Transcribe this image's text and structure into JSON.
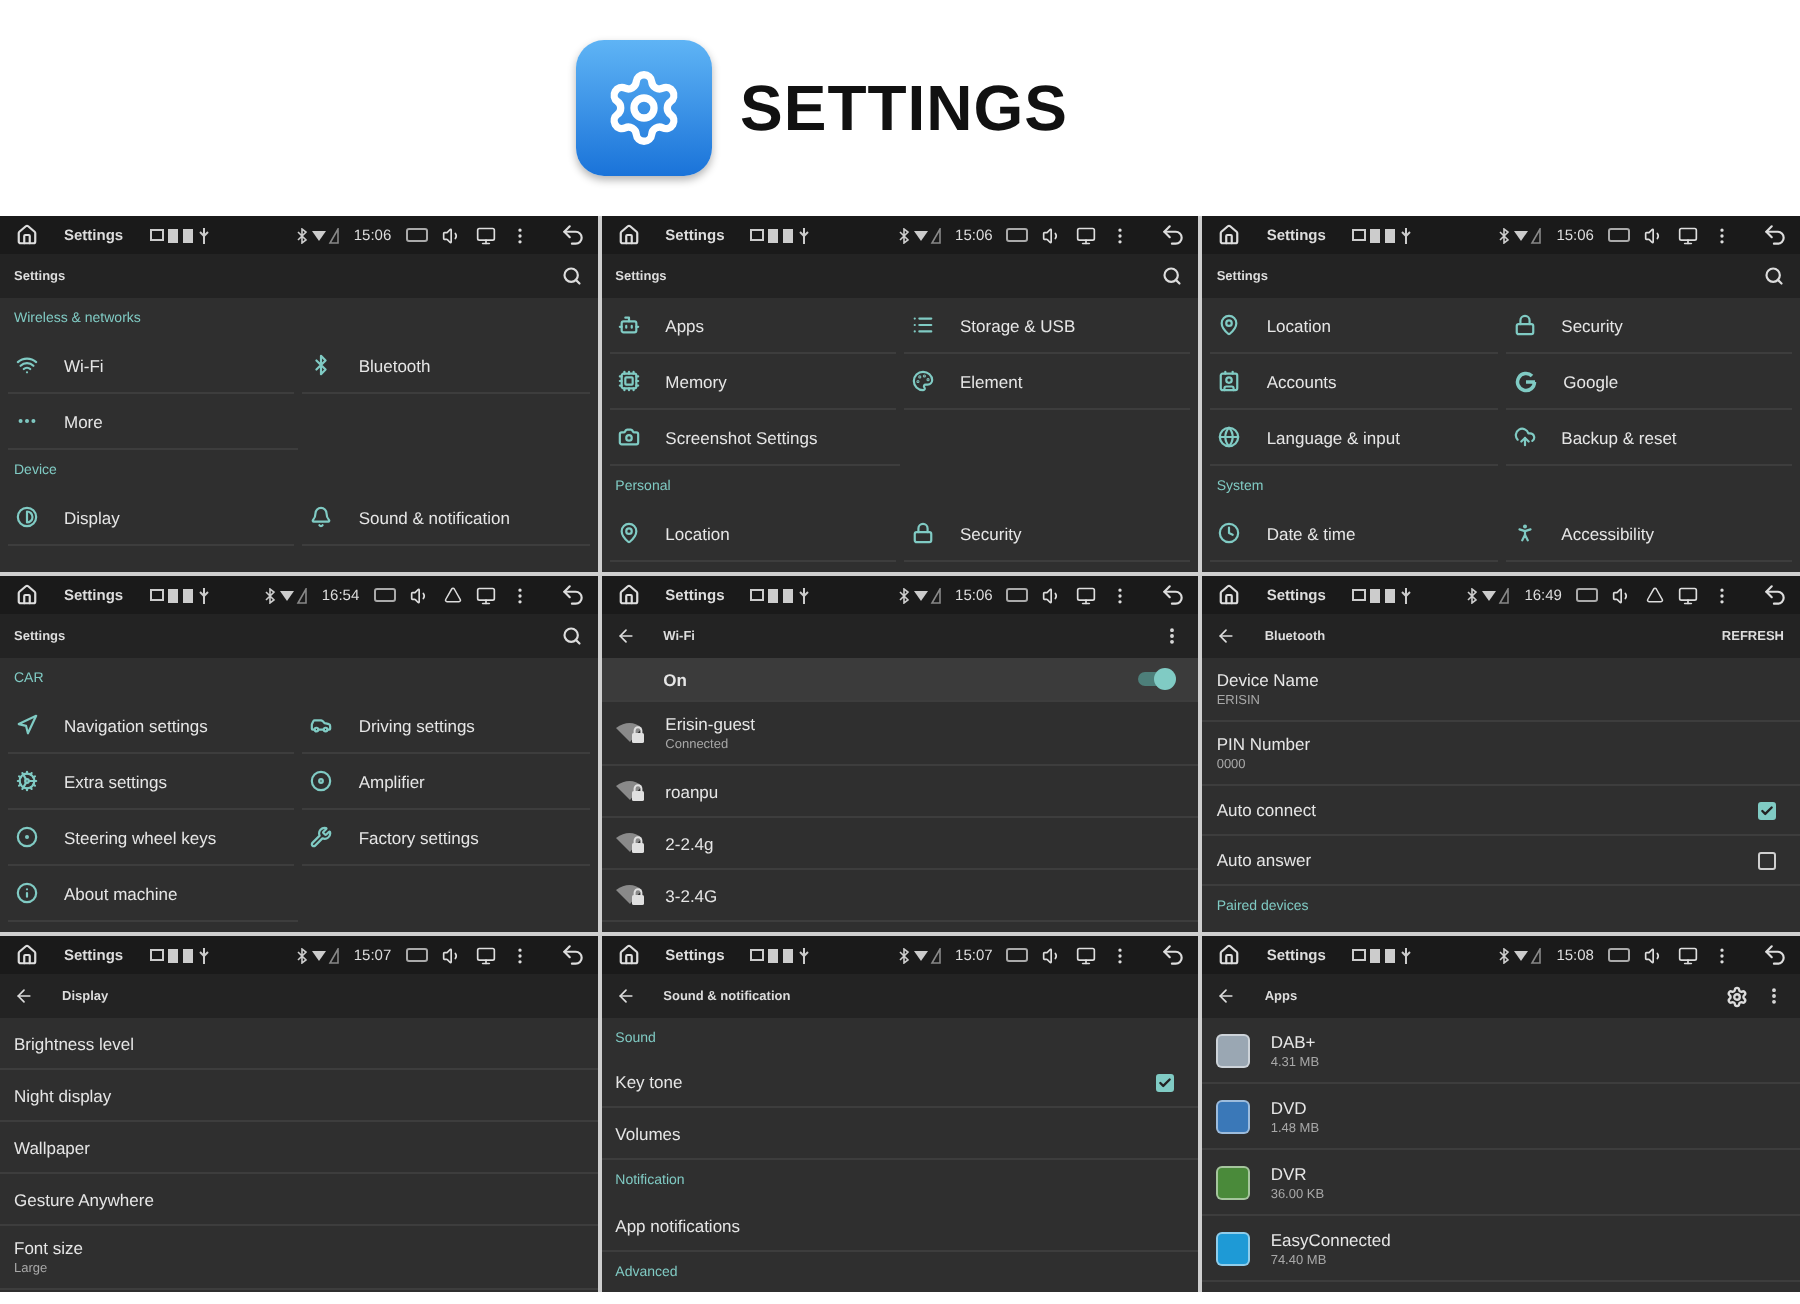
{
  "banner": {
    "title": "SETTINGS"
  },
  "panels": [
    {
      "status": {
        "title": "Settings",
        "time": "15:06",
        "eject": false
      },
      "header": {
        "back": false,
        "title": "Settings",
        "actions": [
          {
            "kind": "search"
          }
        ]
      },
      "rows": [
        {
          "kind": "category",
          "label": "Wireless & networks"
        },
        {
          "kind": "pair",
          "items": [
            "Wi-Fi",
            "Bluetooth"
          ]
        },
        {
          "kind": "pair",
          "items": [
            "More"
          ]
        },
        {
          "kind": "category",
          "label": "Device"
        },
        {
          "kind": "pair",
          "items": [
            "Display",
            "Sound & notification"
          ]
        }
      ]
    },
    {
      "status": {
        "title": "Settings",
        "time": "15:06",
        "eject": false
      },
      "header": {
        "back": false,
        "title": "Settings",
        "actions": [
          {
            "kind": "search"
          }
        ]
      },
      "rows": [
        {
          "kind": "pair",
          "items": [
            "Apps",
            "Storage & USB"
          ]
        },
        {
          "kind": "pair",
          "items": [
            "Memory",
            "Element"
          ]
        },
        {
          "kind": "pair",
          "items": [
            "Screenshot Settings"
          ]
        },
        {
          "kind": "category",
          "label": "Personal"
        },
        {
          "kind": "pair",
          "items": [
            "Location",
            "Security"
          ]
        }
      ]
    },
    {
      "status": {
        "title": "Settings",
        "time": "15:06",
        "eject": false
      },
      "header": {
        "back": false,
        "title": "Settings",
        "actions": [
          {
            "kind": "search"
          }
        ]
      },
      "rows": [
        {
          "kind": "pair",
          "items": [
            "Location",
            "Security"
          ]
        },
        {
          "kind": "pair",
          "items": [
            "Accounts",
            "Google"
          ]
        },
        {
          "kind": "pair",
          "items": [
            "Language & input",
            "Backup & reset"
          ]
        },
        {
          "kind": "category",
          "label": "System"
        },
        {
          "kind": "pair",
          "items": [
            "Date & time",
            "Accessibility"
          ]
        }
      ]
    },
    {
      "status": {
        "title": "Settings",
        "time": "16:54",
        "eject": true
      },
      "header": {
        "back": false,
        "title": "Settings",
        "actions": [
          {
            "kind": "search"
          }
        ]
      },
      "rows": [
        {
          "kind": "category",
          "label": "CAR"
        },
        {
          "kind": "pair",
          "items": [
            "Navigation settings",
            "Driving settings"
          ]
        },
        {
          "kind": "pair",
          "items": [
            "Extra settings",
            "Amplifier"
          ]
        },
        {
          "kind": "pair",
          "items": [
            "Steering wheel keys",
            "Factory settings"
          ]
        },
        {
          "kind": "pair",
          "items": [
            "About machine"
          ]
        }
      ]
    },
    {
      "status": {
        "title": "Settings",
        "time": "15:06",
        "eject": false
      },
      "header": {
        "back": true,
        "title": "Wi-Fi",
        "actions": [
          {
            "kind": "menu"
          }
        ]
      },
      "rows": [
        {
          "kind": "switch",
          "label": "On",
          "on": true
        },
        {
          "kind": "network",
          "label": "Erisin-guest",
          "sub": "Connected"
        },
        {
          "kind": "network",
          "label": "roanpu"
        },
        {
          "kind": "network",
          "label": "2-2.4g"
        },
        {
          "kind": "network",
          "label": "3-2.4G"
        }
      ]
    },
    {
      "status": {
        "title": "Settings",
        "time": "16:49",
        "eject": true
      },
      "header": {
        "back": true,
        "title": "Bluetooth",
        "actions": [
          {
            "kind": "text",
            "label": "REFRESH"
          }
        ]
      },
      "rows": [
        {
          "kind": "detail",
          "label": "Device Name",
          "sub": "ERISIN"
        },
        {
          "kind": "detail",
          "label": "PIN Number",
          "sub": "0000"
        },
        {
          "kind": "check",
          "label": "Auto connect",
          "checked": true
        },
        {
          "kind": "check",
          "label": "Auto answer",
          "checked": false
        },
        {
          "kind": "category",
          "label": "Paired devices"
        }
      ]
    },
    {
      "status": {
        "title": "Settings",
        "time": "15:07",
        "eject": false
      },
      "header": {
        "back": true,
        "title": "Display"
      },
      "rows": [
        {
          "kind": "simple",
          "label": "Brightness level"
        },
        {
          "kind": "simple",
          "label": "Night display"
        },
        {
          "kind": "simple",
          "label": "Wallpaper"
        },
        {
          "kind": "simple",
          "label": "Gesture Anywhere"
        },
        {
          "kind": "detail",
          "label": "Font size",
          "sub": "Large"
        }
      ]
    },
    {
      "status": {
        "title": "Settings",
        "time": "15:07",
        "eject": false
      },
      "header": {
        "back": true,
        "title": "Sound & notification"
      },
      "rows": [
        {
          "kind": "category",
          "label": "Sound"
        },
        {
          "kind": "check",
          "label": "Key tone",
          "checked": true
        },
        {
          "kind": "simple",
          "label": "Volumes"
        },
        {
          "kind": "category",
          "label": "Notification"
        },
        {
          "kind": "simple",
          "label": "App notifications"
        },
        {
          "kind": "category",
          "label": "Advanced"
        }
      ]
    },
    {
      "status": {
        "title": "Settings",
        "time": "15:08",
        "eject": false
      },
      "header": {
        "back": true,
        "title": "Apps",
        "actions": [
          {
            "kind": "gear"
          },
          {
            "kind": "menu"
          }
        ]
      },
      "rows": [
        {
          "kind": "app",
          "label": "DAB+",
          "sub": "4.31 MB"
        },
        {
          "kind": "app",
          "label": "DVD",
          "sub": "1.48 MB"
        },
        {
          "kind": "app",
          "label": "DVR",
          "sub": "36.00 KB"
        },
        {
          "kind": "app",
          "label": "EasyConnected",
          "sub": "74.40 MB"
        }
      ]
    }
  ]
}
